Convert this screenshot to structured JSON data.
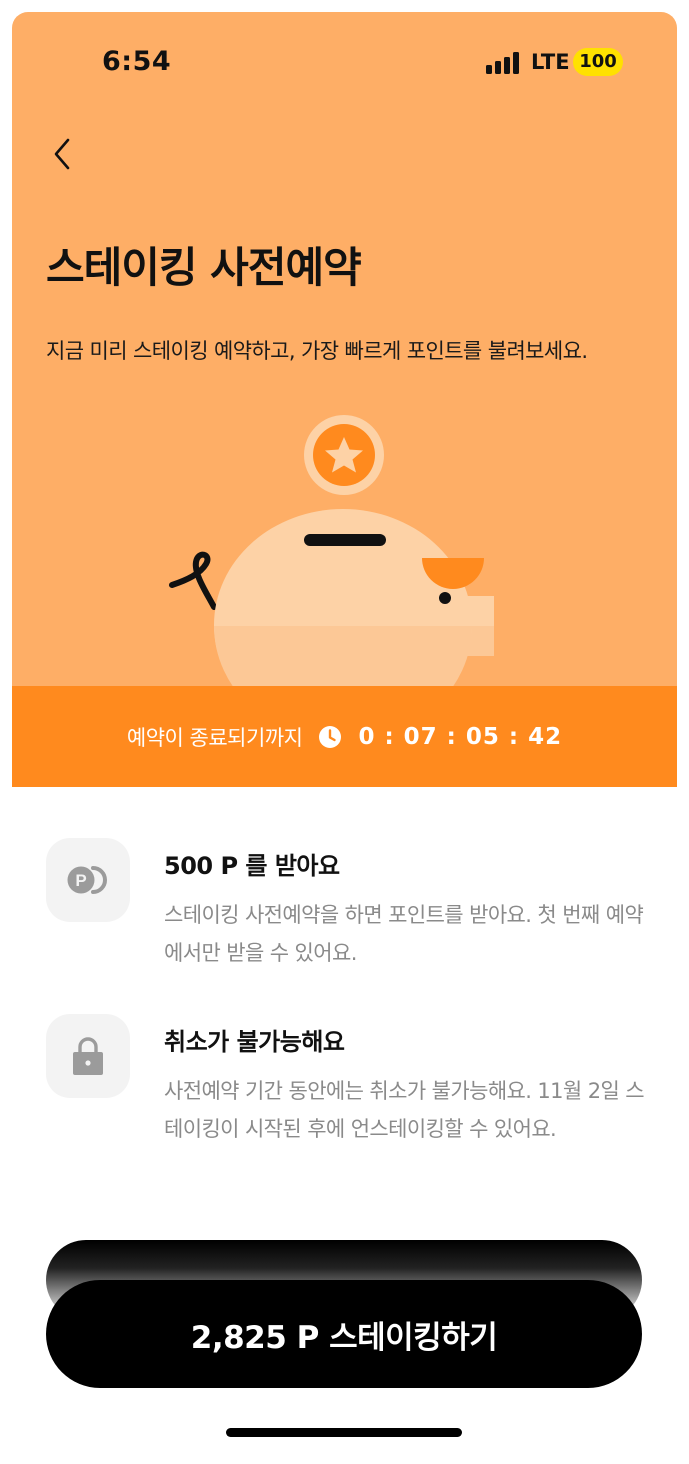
{
  "status_bar": {
    "time": "6:54",
    "network": "LTE",
    "battery": "100"
  },
  "header": {
    "back_icon": "chevron-left-icon",
    "title": "스테이킹 사전예약",
    "subtitle": "지금 미리 스테이킹 예약하고, 가장 빠르게 포인트를 불려보세요."
  },
  "illustration": {
    "icon": "piggy-bank-coin-icon",
    "colors": {
      "background": "#FEAE66",
      "coin_outer": "#FDD2A6",
      "coin_inner": "#FF8A1E",
      "pig_body": "#FDD2A6",
      "pig_belly": "#FCC896"
    }
  },
  "countdown": {
    "label": "예약이 종료되기까지",
    "icon": "clock-icon",
    "value": "0 : 07 : 05 : 42"
  },
  "info_items": [
    {
      "icon": "point-coins-icon",
      "title": "500 P 를 받아요",
      "description": "스테이킹 사전예약을 하면 포인트를 받아요. 첫 번째 예약에서만 받을 수 있어요."
    },
    {
      "icon": "lock-icon",
      "title": "취소가 불가능해요",
      "description": "사전예약 기간 동안에는 취소가 불가능해요. 11월 2일 스테이킹이 시작된 후에 언스테이킹할 수 있어요."
    }
  ],
  "cta": {
    "label": "2,825 P 스테이킹하기"
  },
  "colors": {
    "hero": "#FEAE66",
    "countdown_bar": "#FF8A1E",
    "cta": "#000000",
    "battery_badge": "#FFE100"
  }
}
